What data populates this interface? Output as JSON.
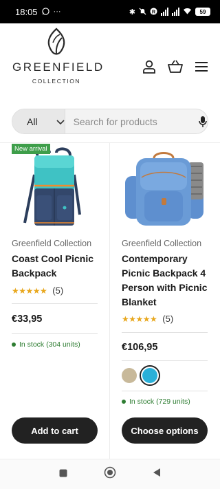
{
  "status_bar": {
    "time": "18:05",
    "battery": "59"
  },
  "brand": {
    "name": "GREENFIELD",
    "subtitle": "COLLECTION"
  },
  "search": {
    "category": "All",
    "placeholder": "Search for products"
  },
  "products": [
    {
      "badge": "New arrival",
      "brand": "Greenfield Collection",
      "title": "Coast Cool Picnic Backpack",
      "stars": "★★★★★",
      "rating_count": "(5)",
      "price": "€33,95",
      "stock": "In stock (304 units)",
      "button": "Add to cart"
    },
    {
      "brand": "Greenfield Collection",
      "title": "Contemporary Picnic Backpack 4 Person with Picnic Blanket",
      "stars": "★★★★★",
      "rating_count": "(5)",
      "price": "€106,95",
      "swatch_colors": [
        "#c8b99a",
        "#2ab0d8"
      ],
      "stock": "In stock (729 units)",
      "button": "Choose options"
    }
  ],
  "colors": {
    "badge": "#3e9e4a",
    "stock": "#2e7d32",
    "stars": "#e8a71c",
    "button": "#222222"
  }
}
